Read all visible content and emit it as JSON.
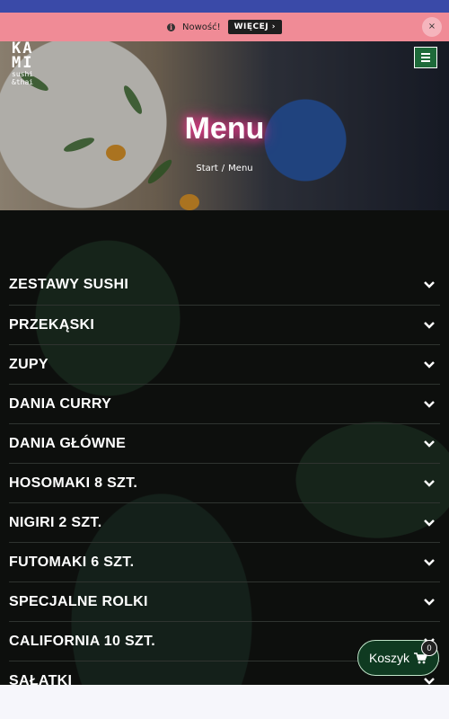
{
  "notice": {
    "text": "Nowość!",
    "more_label": "WIĘCEJ ›",
    "close_label": "×"
  },
  "logo": {
    "line1": "KA",
    "line2": "MI",
    "line3": "sushi",
    "line4": "&thai"
  },
  "hero": {
    "title": "Menu",
    "breadcrumb": [
      "Start",
      "/",
      "Menu"
    ]
  },
  "menu": {
    "items": [
      {
        "label": "ZESTAWY SUSHI"
      },
      {
        "label": "PRZEKĄSKI"
      },
      {
        "label": "ZUPY"
      },
      {
        "label": "DANIA CURRY"
      },
      {
        "label": "DANIA GŁÓWNE"
      },
      {
        "label": "HOSOMAKI 8 SZT."
      },
      {
        "label": "NIGIRI 2 SZT."
      },
      {
        "label": "FUTOMAKI 6 SZT."
      },
      {
        "label": "SPECJALNE ROLKI"
      },
      {
        "label": "CALIFORNIA 10 SZT."
      },
      {
        "label": "SAŁATKI"
      }
    ]
  },
  "cart": {
    "label": "Koszyk",
    "count": "0"
  },
  "colors": {
    "topbar": "#3a4aa8",
    "notice": "#f08b96",
    "accent_green": "#0f3a21",
    "title_glow": "#e8338a"
  }
}
